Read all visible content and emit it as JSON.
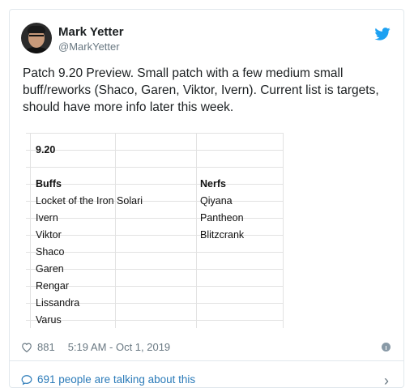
{
  "tweet": {
    "author": {
      "name": "Mark Yetter",
      "handle": "@MarkYetter"
    },
    "text": "Patch 9.20 Preview. Small patch with a few medium small buff/reworks (Shaco, Garen, Viktor, Ivern). Current list is targets, should have more info later this week.",
    "spreadsheet": {
      "title": "9.20",
      "headers": {
        "buffs": "Buffs",
        "nerfs": "Nerfs"
      },
      "buffs": [
        "Locket of the Iron Solari",
        "Ivern",
        "Viktor",
        "Shaco",
        "Garen",
        "Rengar",
        "Lissandra",
        "Varus"
      ],
      "nerfs": [
        "Qiyana",
        "Pantheon",
        "Blitzcrank"
      ]
    },
    "likes": "881",
    "timestamp": "5:19 AM - Oct 1, 2019",
    "talking": "691 people are talking about this"
  },
  "colors": {
    "link": "#2b7bb9",
    "twitter_blue": "#1da1f2",
    "muted": "#697882"
  },
  "icons": [
    "twitter-bird-icon",
    "heart-icon",
    "info-icon",
    "comment-icon",
    "chevron-right-icon"
  ]
}
